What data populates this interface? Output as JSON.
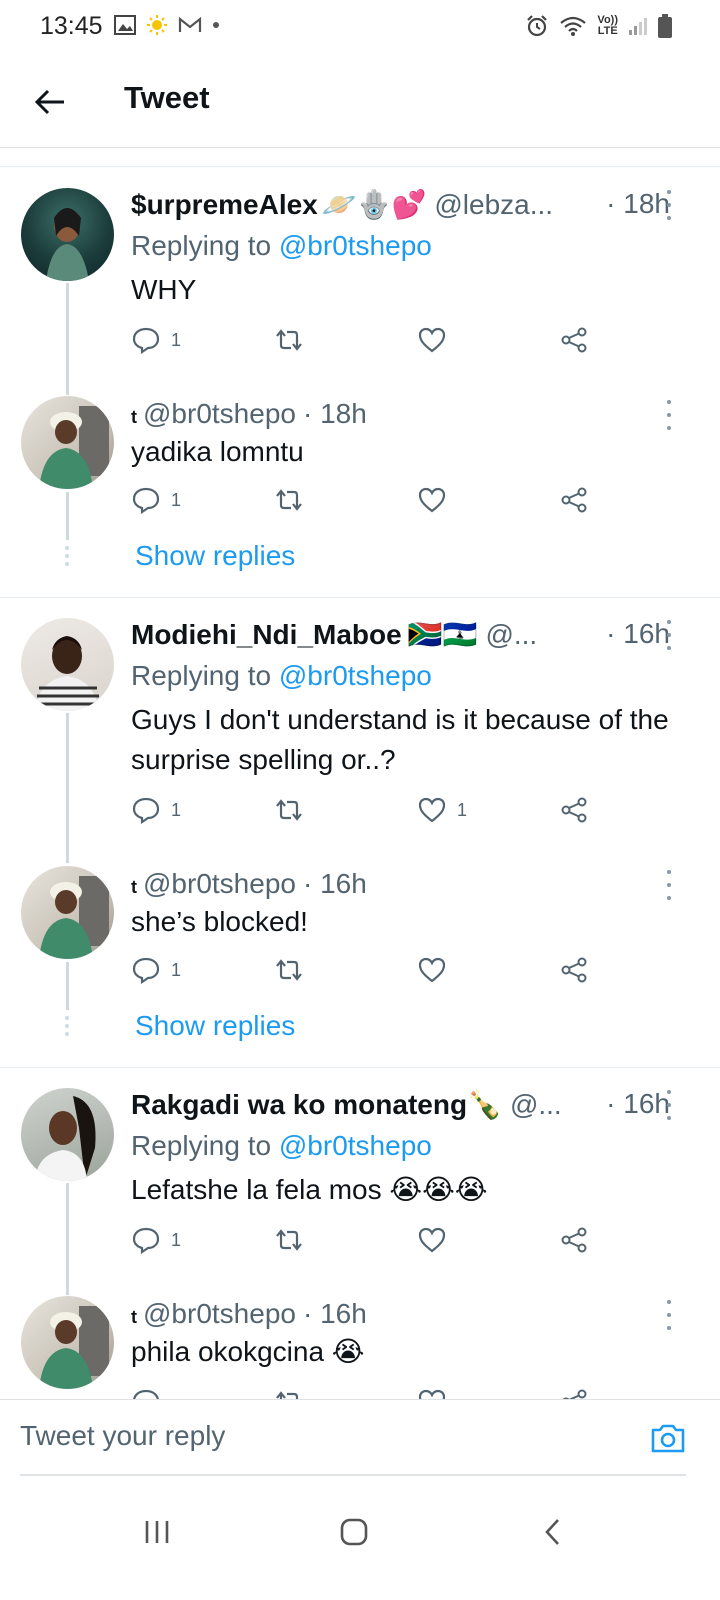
{
  "status_bar": {
    "time": "13:45",
    "lte_top": "Vo))",
    "lte_bottom": "LTE"
  },
  "header": {
    "title": "Tweet",
    "back_icon": "arrow-left-icon"
  },
  "tweets": [
    {
      "name": "$urpremeAlex",
      "name_emoji": "🪐🪬💕",
      "handle": "@lebza...",
      "time": "· 18h",
      "replying_label": "Replying to ",
      "replying_handle": "@br0tshepo",
      "body": "WHY",
      "reply_count": "1",
      "like_count": ""
    },
    {
      "name_prefix": "t",
      "handle": "@br0tshepo",
      "time": "· 18h",
      "body": "yadika lomntu",
      "reply_count": "1",
      "like_count": ""
    },
    {
      "name": "Modiehi_Ndi_Maboe",
      "name_emoji": "🇿🇦🇱🇸",
      "handle": "@...",
      "time": "· 16h",
      "replying_label": "Replying to ",
      "replying_handle": "@br0tshepo",
      "body": "Guys I don't understand is it because of the surprise spelling or..?",
      "reply_count": "1",
      "like_count": "1"
    },
    {
      "name_prefix": "t",
      "handle": "@br0tshepo",
      "time": "· 16h",
      "body": "she’s blocked!",
      "reply_count": "1",
      "like_count": ""
    },
    {
      "name": "Rakgadi wa ko monateng",
      "name_emoji": "🍾",
      "handle": "@...",
      "time": "· 16h",
      "replying_label": "Replying to ",
      "replying_handle": "@br0tshepo",
      "body": "Lefatshe la fela mos 😭😭😭",
      "reply_count": "1",
      "like_count": ""
    },
    {
      "name_prefix": "t",
      "handle": "@br0tshepo",
      "time": "· 16h",
      "body": "phila okokgcina 😭"
    }
  ],
  "show_replies_label": "Show replies",
  "reply_box": {
    "placeholder": "Tweet your reply",
    "camera_icon": "camera-icon"
  },
  "colors": {
    "accent": "#1d9bf0",
    "text": "#0f1419",
    "secondary": "#536471",
    "line": "#cfd9de"
  }
}
